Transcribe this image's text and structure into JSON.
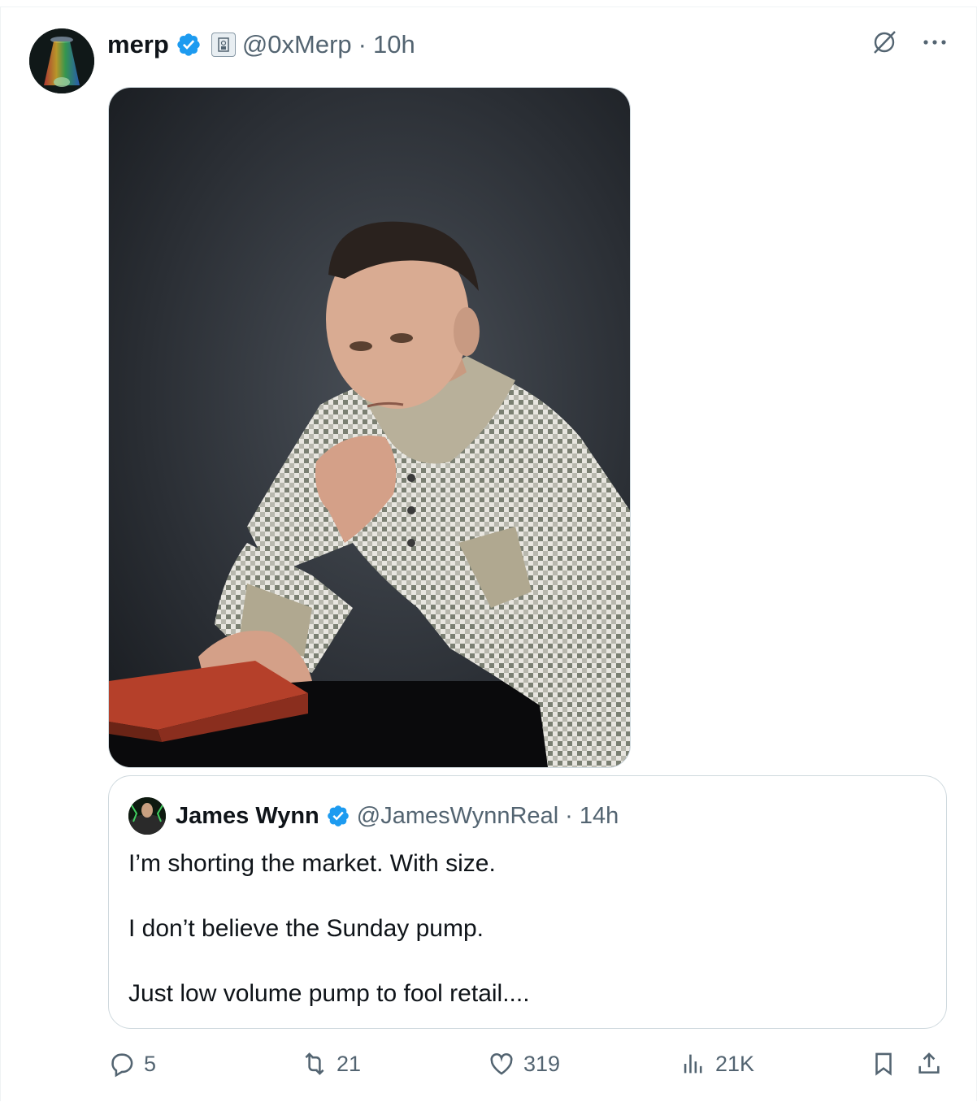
{
  "tweet": {
    "author_name": "merp",
    "author_handle": "@0xMerp",
    "separator": "·",
    "time": "10h"
  },
  "quoted": {
    "author_name": "James Wynn",
    "author_handle": "@JamesWynnReal",
    "separator": "·",
    "time": "14h",
    "lines": [
      "I’m shorting the market. With size.",
      "I don’t believe the Sunday pump.",
      "Just low volume pump to fool retail...."
    ]
  },
  "actions": {
    "replies": "5",
    "reposts": "21",
    "likes": "319",
    "views": "21K"
  },
  "icons": [
    "verified-badge-icon",
    "affiliate-badge-icon",
    "grok-icon",
    "more-icon",
    "reply-icon",
    "repost-icon",
    "like-icon",
    "views-icon",
    "bookmark-icon",
    "share-icon"
  ],
  "colors": {
    "verified": "#1d9bf0",
    "secondary_text": "#536471",
    "border": "#cfd9de"
  }
}
